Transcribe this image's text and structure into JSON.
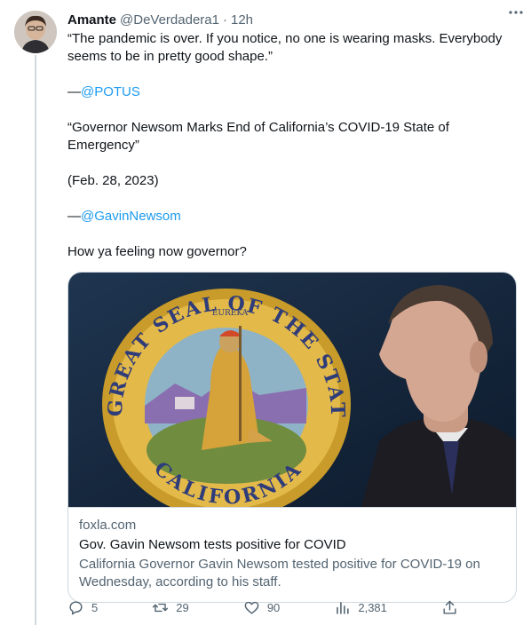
{
  "tweet": {
    "author_name": "Amante",
    "author_handle": "@DeVerdadera1",
    "separator": "·",
    "time": "12h",
    "lines": {
      "l1": "“The pandemic is over. If you notice, no one is wearing masks. Everybody seems to be in pretty good shape.”",
      "l2_prefix": "—",
      "l2_mention": "@POTUS",
      "l3": "“Governor Newsom Marks End of California’s COVID-19 State of Emergency”",
      "l4": "(Feb. 28, 2023)",
      "l5_prefix": "—",
      "l5_mention": "@GavinNewsom",
      "l6": "How ya feeling now governor?"
    }
  },
  "card": {
    "domain": "foxla.com",
    "title": "Gov. Gavin Newsom tests positive for COVID",
    "description": "California Governor Gavin Newsom tested positive for COVID-19 on Wednesday, according to his staff.",
    "seal": {
      "top_text": "THE GREAT SEAL OF THE STATE OF",
      "bottom_text": "CALIFORNIA",
      "motto": "EUREKA"
    }
  },
  "actions": {
    "replies": "5",
    "retweets": "29",
    "likes": "90",
    "views": "2,381"
  },
  "colors": {
    "accent": "#1d9bf0",
    "secondary_text": "#536471",
    "border": "#cfd9de"
  }
}
